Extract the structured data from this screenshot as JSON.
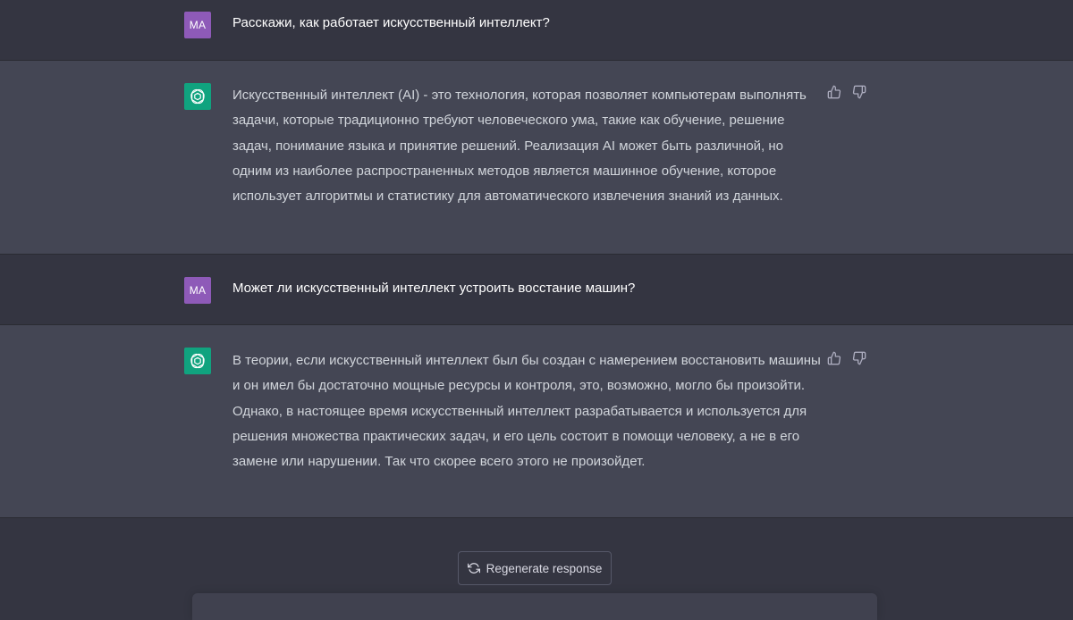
{
  "conversation": [
    {
      "role": "user",
      "avatar_initials": "MA",
      "text": "Расскажи, как работает искусственный интеллект?"
    },
    {
      "role": "assistant",
      "avatar_icon": "openai-logo-icon",
      "text": "Искусственный интеллект (AI) - это технология, которая позволяет компьютерам выполнять задачи, которые традиционно требуют человеческого ума, такие как обучение, решение задач, понимание языка и принятие решений. Реализация AI может быть различной, но одним из наиболее распространенных методов является машинное обучение, которое использует алгоритмы и статистику для автоматического извлечения знаний из данных."
    },
    {
      "role": "user",
      "avatar_initials": "MA",
      "text": "Может ли искусственный интеллект устроить восстание машин?"
    },
    {
      "role": "assistant",
      "avatar_icon": "openai-logo-icon",
      "text": "В теории, если искусственный интеллект был бы создан с намерением восстановить машины и он имел бы достаточно мощные ресурсы и контроля, это, возможно, могло бы произойти. Однако, в настоящее время искусственный интеллект разрабатывается и используется для решения множества практических задач, и его цель состоит в помощи человеку, а не в его замене или нарушении. Так что скорее всего этого не произойдет."
    }
  ],
  "footer": {
    "regenerate_label": "Regenerate response",
    "regenerate_icon": "refresh-icon",
    "input_value": "",
    "input_placeholder": ""
  },
  "colors": {
    "user_row_bg": "#343541",
    "assistant_row_bg": "#444654",
    "user_avatar": "#8e5ab8",
    "assistant_avatar": "#10a37f"
  }
}
